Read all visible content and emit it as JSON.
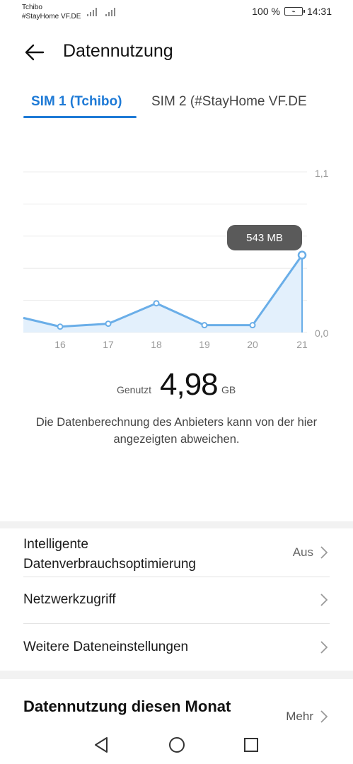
{
  "status_bar": {
    "carrier_1": "Tchibo",
    "carrier_2": "#StayHome VF.DE",
    "battery": "100 %",
    "time": "14:31"
  },
  "header": {
    "title": "Datennutzung",
    "back_icon": "arrow-left-icon"
  },
  "tabs": [
    {
      "label": "SIM 1 (Tchibo)",
      "active": true
    },
    {
      "label": "SIM 2 (#StayHome VF.DE",
      "active": false
    }
  ],
  "chart_data": {
    "type": "area",
    "x": [
      "15",
      "16",
      "17",
      "18",
      "19",
      "20",
      "21"
    ],
    "xtick_labels": [
      "16",
      "17",
      "18",
      "19",
      "20",
      "21"
    ],
    "values_gb": [
      0.1,
      0.04,
      0.06,
      0.2,
      0.05,
      0.05,
      0.53
    ],
    "ylim": [
      0.0,
      1.1
    ],
    "ytick_labels": [
      "1,1",
      "0,0"
    ],
    "highlight_label": "543 MB",
    "color": "#6aaee8",
    "grid": true
  },
  "usage": {
    "label": "Genutzt",
    "value": "4,98",
    "unit": "GB",
    "notice": "Die Datenberechnung des Anbieters kann von der hier angezeigten abweichen."
  },
  "settings": {
    "optimize_title": "Intelligente Datenverbrauchsoptimierung",
    "optimize_value": "Aus",
    "network_access": "Netzwerkzugriff",
    "more_settings": "Weitere Dateneinstellungen"
  },
  "month_section": {
    "title": "Datennutzung diesen Monat",
    "more_label": "Mehr"
  },
  "colors": {
    "accent": "#1e7ad6",
    "chart_line": "#6aaee8",
    "tooltip_bg": "#5a5a5a"
  }
}
